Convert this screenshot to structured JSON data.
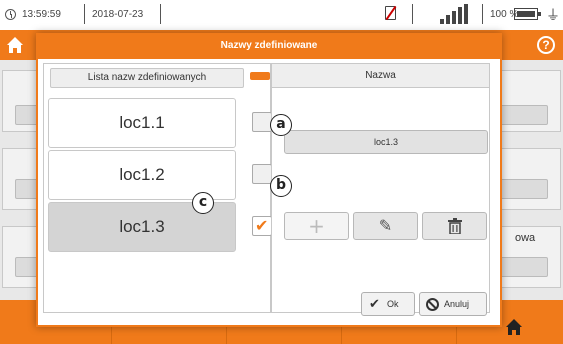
{
  "status_bar": {
    "time": "13:59:59",
    "date": "2018-07-23",
    "battery_percent": "100 %",
    "icons": [
      "clock-icon",
      "no-sim-icon",
      "signal-icon",
      "battery-icon",
      "plug-icon"
    ]
  },
  "header": {
    "icons": [
      "home-icon",
      "help-icon"
    ],
    "help_glyph": "?"
  },
  "background": {
    "side_label": "owa"
  },
  "dialog": {
    "title": "Nazwy zdefiniowane",
    "list_header": "Lista nazw zdefiniowanych",
    "items": [
      {
        "label": "loc1.1",
        "checked": false,
        "selected": false
      },
      {
        "label": "loc1.2",
        "checked": false,
        "selected": false
      },
      {
        "label": "loc1.3",
        "checked": true,
        "selected": true
      }
    ],
    "name_header": "Nazwa",
    "name_value": "loc1.3",
    "actions": [
      "add-icon",
      "edit-icon",
      "delete-icon"
    ],
    "add_glyph": "+",
    "edit_glyph": "✎",
    "delete_glyph": "🗑",
    "ok_label": "Ok",
    "cancel_label": "Anuluj"
  },
  "callouts": {
    "a": "a",
    "b": "b",
    "c": "c"
  },
  "colors": {
    "accent": "#f07a1a",
    "selected_item": "#d4d4d4"
  }
}
